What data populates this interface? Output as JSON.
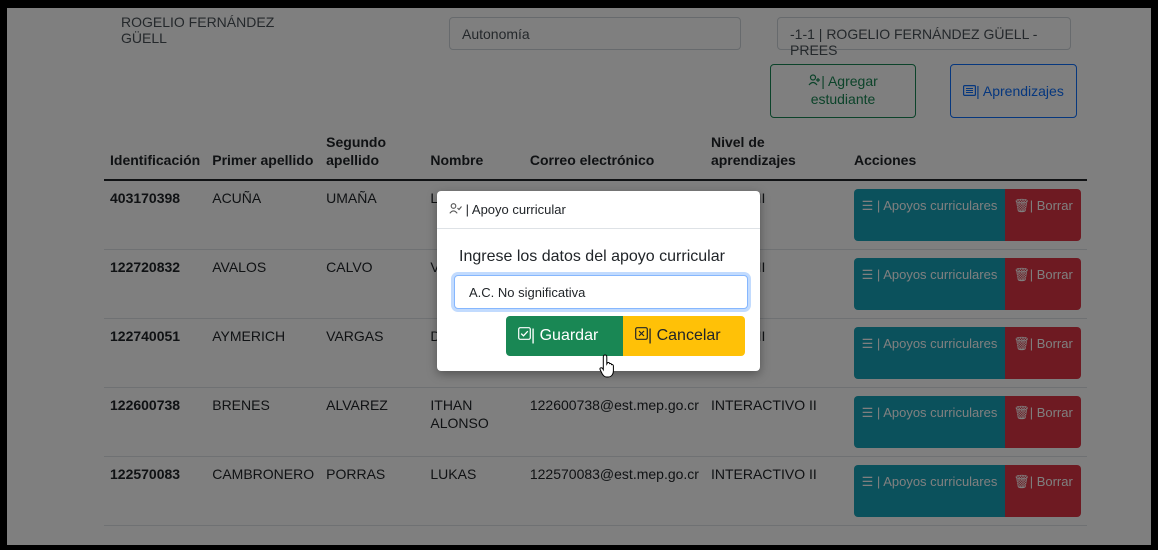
{
  "header": {
    "teacher_name": "ROGELIO FERNÁNDEZ GÜELL",
    "autonomy_field": "Autonomía",
    "docente_field": "-1-1 | ROGELIO FERNÁNDEZ GÜELL - PREES"
  },
  "toolbar": {
    "add_student_label": "| Agregar estudiante",
    "learnings_label": "| Aprendizajes"
  },
  "table": {
    "columns": [
      "Identificación",
      "Primer apellido",
      "Segundo apellido",
      "Nombre",
      "Correo electrónico",
      "Nivel de aprendizajes",
      "Acciones"
    ],
    "rows": [
      {
        "id": "403170398",
        "apellido1": "ACUÑA",
        "apellido2": "UMAÑA",
        "nombre": "LU",
        "correo": "",
        "nivel": "CTIVO II"
      },
      {
        "id": "122720832",
        "apellido1": "AVALOS",
        "apellido2": "CALVO",
        "nombre": "VI",
        "correo": "",
        "nivel": "CTIVO II"
      },
      {
        "id": "122740051",
        "apellido1": "AYMERICH",
        "apellido2": "VARGAS",
        "nombre": "DE IS",
        "correo": "",
        "nivel": "CTIVO II"
      },
      {
        "id": "122600738",
        "apellido1": "BRENES",
        "apellido2": "ALVAREZ",
        "nombre": "ITHAN ALONSO",
        "correo": "122600738@est.mep.go.cr",
        "nivel": "INTERACTIVO II"
      },
      {
        "id": "122570083",
        "apellido1": "CAMBRONERO",
        "apellido2": "PORRAS",
        "nombre": "LUKAS",
        "correo": "122570083@est.mep.go.cr",
        "nivel": "INTERACTIVO II"
      }
    ],
    "support_button_label": "| Apoyos curriculares",
    "delete_button_label": "| Borrar"
  },
  "modal": {
    "title": "| Apoyo curricular",
    "prompt": "Ingrese los datos del apoyo curricular",
    "input_value": "A.C. No significativa",
    "save_label": "| Guardar",
    "cancel_label": "| Cancelar"
  },
  "colors": {
    "info": "#17a2b8",
    "danger": "#dc3545",
    "success": "#198754",
    "warning": "#ffc107",
    "primary": "#0d6efd"
  }
}
